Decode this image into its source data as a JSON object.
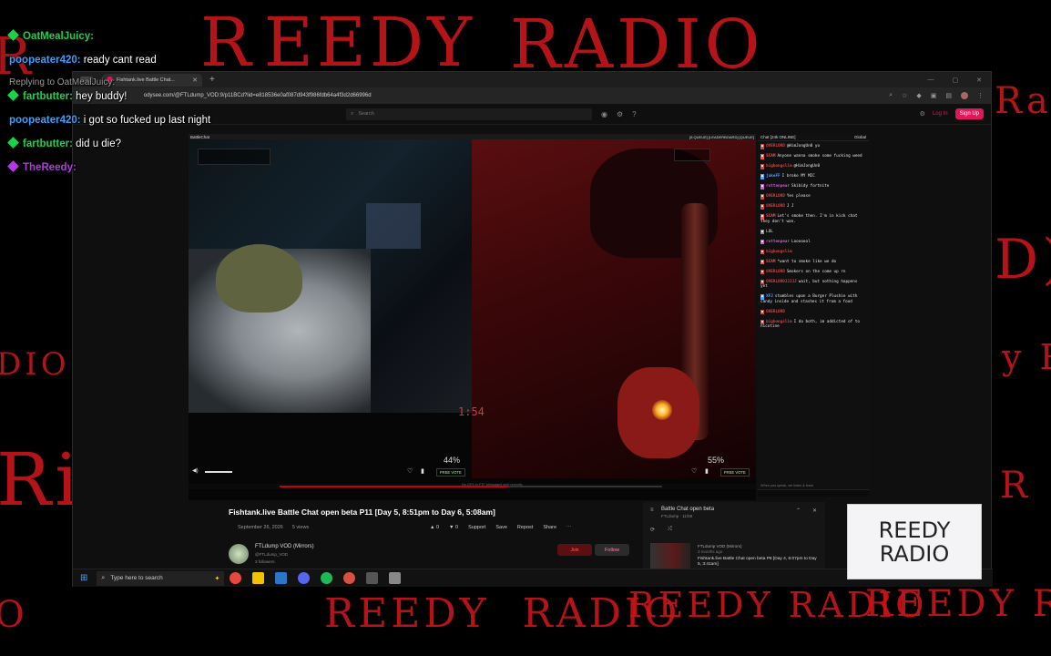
{
  "overlay": {
    "watermark": "REEDY RADIO",
    "logo_text": "REEDY RADIO",
    "stream_chat": [
      {
        "user": "OatMealJuicy:",
        "text": "",
        "color": "#19d44a"
      },
      {
        "user": "poopeater420:",
        "text": "ready cant read",
        "color": "#3aa0ff"
      },
      {
        "user": "Replying to OatMealJuicy:",
        "text": "",
        "color": "#9a9a9a"
      },
      {
        "user": "fartbutter:",
        "text": "hey buddy!",
        "color": "#19d44a"
      },
      {
        "user": "poopeater420:",
        "text": "i got so fucked up last night",
        "color": "#3aa0ff"
      },
      {
        "user": "fartbutter:",
        "text": "did u die?",
        "color": "#19d44a"
      },
      {
        "user": "TheReedy:",
        "text": "",
        "color": "#b13ae0"
      }
    ]
  },
  "browser": {
    "tab_title": "Fishtank.live Battle Chat...",
    "url": "odysee.com/@FTLdump_VOD:9/p11BCd?lid=e818536e0af087d943f986fdb64a4f3d2d66996d",
    "site": {
      "search_placeholder": "Search",
      "login": "Log In",
      "signup": "Sign Up"
    }
  },
  "stream": {
    "top_left_label": "BattleChat",
    "top_right_label": "[8 QUEUE] [LEADERBOARD] [QUEUE]",
    "left_percent": "44%",
    "right_percent": "55%",
    "timer": "1:54",
    "free_vote": "FREE VOTE",
    "chat_header": "Chat [24k ONLINE]",
    "chat_global": "Global",
    "chat_messages": [
      {
        "name": "OVERLORD",
        "text": "@HimJongUn0 yo",
        "color": "#d04444"
      },
      {
        "name": "SCAM",
        "text": "Anyone wanna smoke some fucking weed",
        "color": "#f05050"
      },
      {
        "name": "bigbongslim",
        "text": "@HimJongUn0",
        "color": "#d04444"
      },
      {
        "name": "jakeFF",
        "text": "I broke MY MIC",
        "color": "#4aa0ff"
      },
      {
        "name": "rottenpear",
        "text": "Skibidy fortnite",
        "color": "#d05acd"
      },
      {
        "name": "OVERLORD",
        "text": "Yes please",
        "color": "#d04444"
      },
      {
        "name": "OVERLORD",
        "text": "J J",
        "color": "#d04444"
      },
      {
        "name": "SCAM",
        "text": "Let's smoke then. I'm in kick chat they don't wan.",
        "color": "#f05050"
      },
      {
        "name": "",
        "text": "LOL",
        "color": "#888888"
      },
      {
        "name": "rottenpear",
        "text": "Looooool",
        "color": "#d05acd"
      },
      {
        "name": "bigbongslim",
        "text": "",
        "color": "#d04444"
      },
      {
        "name": "SCAM",
        "text": "*want to smoke like we do",
        "color": "#f05050"
      },
      {
        "name": "OVERLORD",
        "text": "Smokers on the come up rn",
        "color": "#d04444"
      },
      {
        "name": "OVERLORDJJJJJ",
        "text": "wait, but nothing happens yet",
        "color": "#d04444"
      },
      {
        "name": "XFJ",
        "text": "stumbles upon a Burger Plushie with candy inside and stashes it from a food",
        "color": "#4aa0ff"
      },
      {
        "name": "OVERLORD",
        "text": "",
        "color": "#d04444"
      },
      {
        "name": "bigbongslim",
        "text": "I do both, im addicted of to nicotine",
        "color": "#d04444"
      }
    ],
    "chat_footer": "When you speak, we listen & learn",
    "progress_text": "No GFS in FTF Messages sent recently"
  },
  "video_page": {
    "title": "Fishtank.live Battle Chat open beta P11 [Day 5, 8:51pm to Day 6, 5:08am]",
    "date": "September 26, 2026",
    "views": "5 views",
    "likes": "0",
    "dislikes": "0",
    "actions": [
      "Support",
      "Save",
      "Repost",
      "Share"
    ],
    "channel_name": "FTLdump VOD (Mirrors)",
    "channel_handle": "@FTLdump_VOD",
    "followers": "3 followers",
    "join": "Join",
    "follow": "Follow",
    "playlist_title": "Battle Chat open beta",
    "playlist_sub": "FTLdump · 11/59",
    "next_item_channel": "FTLdump VOD (Mirrors)",
    "next_item_ago": "3 months ago",
    "next_item_title": "Fishtank.live Battle Chat open beta P8 [Day 4, 6:07pm to Day 5, 3:41am]",
    "next_item_duration": "07:35:32"
  },
  "taskbar": {
    "search_placeholder": "Type here to search"
  },
  "colors": {
    "accent_red": "#c8161b",
    "site_pink": "#e3165b",
    "chat_bg": "#101010"
  }
}
